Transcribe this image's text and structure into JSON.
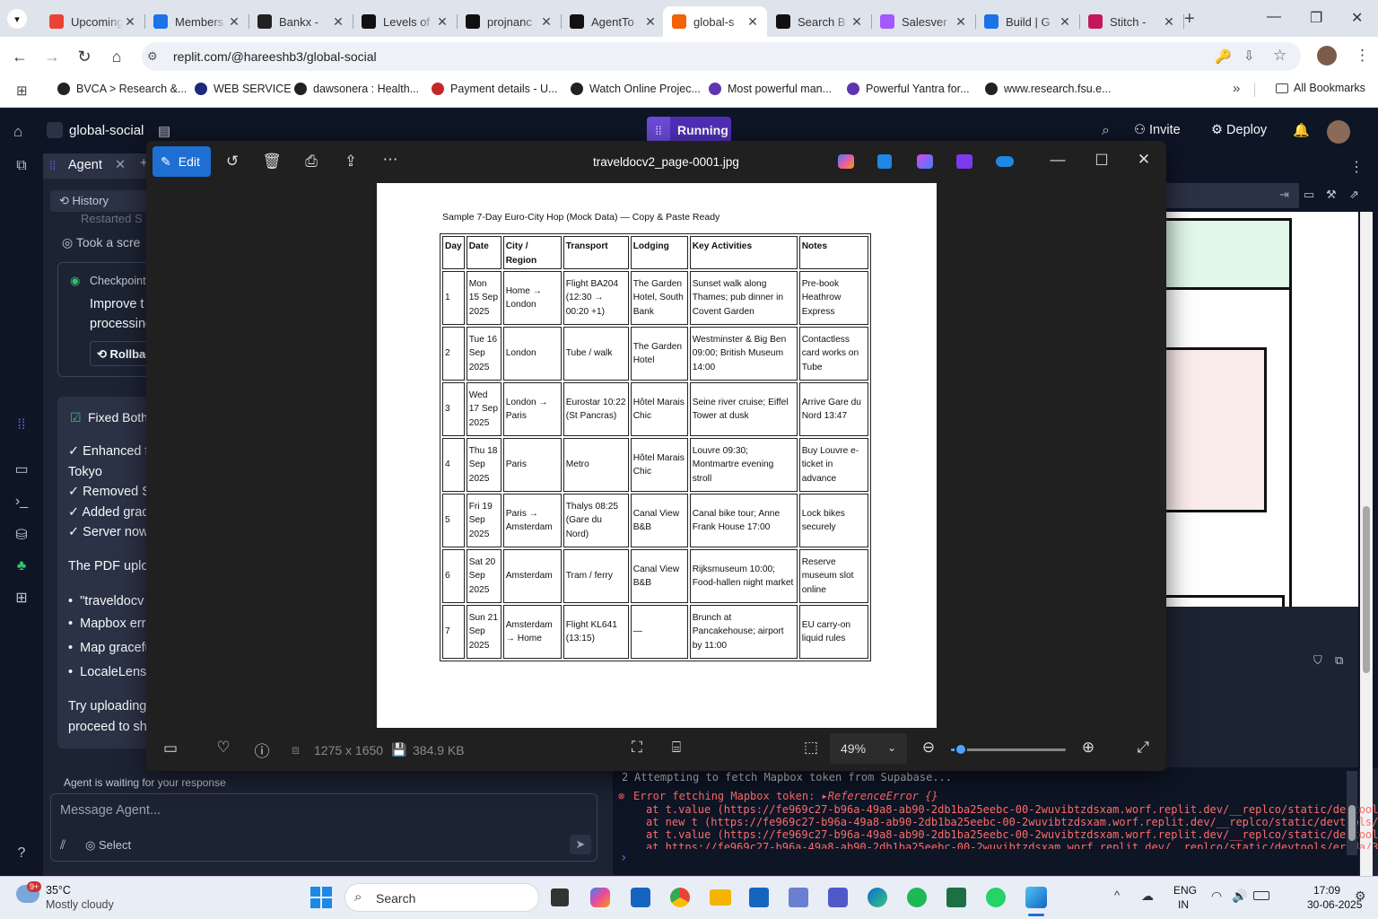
{
  "browser": {
    "tabs": [
      {
        "title": "Upcoming",
        "icon": "gmail-icon",
        "color": "#ea4335"
      },
      {
        "title": "Members",
        "icon": "globe-icon",
        "color": "#1a73e8"
      },
      {
        "title": "Bankx - ",
        "icon": "openai-icon",
        "color": "#222222"
      },
      {
        "title": "Levels of",
        "icon": "notion-icon",
        "color": "#111111"
      },
      {
        "title": "projnanc",
        "icon": "github-icon",
        "color": "#111111"
      },
      {
        "title": "AgentTo",
        "icon": "github-icon",
        "color": "#111111"
      },
      {
        "title": "global-s",
        "icon": "replit-icon",
        "color": "#f26207",
        "active": true
      },
      {
        "title": "Search B",
        "icon": "perplexity-icon",
        "color": "#111111"
      },
      {
        "title": "Salesver",
        "icon": "figma-icon",
        "color": "#a259ff"
      },
      {
        "title": "Build | G",
        "icon": "build-icon",
        "color": "#1a73e8"
      },
      {
        "title": "Stitch - ",
        "icon": "stitch-icon",
        "color": "#c2185b"
      }
    ],
    "url": "replit.com/@hareeshb3/global-social",
    "bookmarks": [
      {
        "label": "BVCA > Research &...",
        "color": "#222"
      },
      {
        "label": "WEB SERVICE",
        "color": "#1b2a7a"
      },
      {
        "label": "dawsonera : Health...",
        "color": "#222"
      },
      {
        "label": "Payment details - U...",
        "color": "#c62828"
      },
      {
        "label": "Watch Online Projec...",
        "color": "#222"
      },
      {
        "label": "Most powerful man...",
        "color": "#5e35b1"
      },
      {
        "label": "Powerful Yantra for...",
        "color": "#5e35b1"
      },
      {
        "label": "www.research.fsu.e...",
        "color": "#222"
      }
    ],
    "all_bookmarks": "All Bookmarks"
  },
  "replit": {
    "project": "global-social",
    "status": "Running",
    "invite": "Invite",
    "deploy": "Deploy",
    "agent_tab": "Agent",
    "history": "History",
    "restarted": "Restarted S",
    "took_screenshot": "Took a scre",
    "checkpoint": "Checkpoint",
    "checkpoint_desc_1": "Improve t",
    "checkpoint_desc_2": "processing",
    "rollback": "Rollbac",
    "fixed_title": "Fixed Both",
    "msg_lines": [
      "✓ Enhanced fi",
      "Tokyo",
      "✓ Removed Su",
      "✓ Added grac",
      "✓ Server now"
    ],
    "pdf_upload": "The PDF uploa",
    "bullets": [
      "\"traveldocv",
      "Mapbox erro",
      "Map gracefu",
      "LocaleLens"
    ],
    "try_lines": [
      "Try uploading",
      "proceed to sh"
    ],
    "waiting": "Agent is waiting for your response",
    "message_placeholder": "Message Agent...",
    "select": "Select",
    "console": {
      "line_num": "2",
      "line1": "Attempting to fetch Mapbox token from Supabase...",
      "error": "Error fetching Mapbox token: ",
      "error_type": "ReferenceError {}",
      "stack": [
        "at t.value (https://fe969c27-b96a-49a8-ab90-2db1ba25eebc-00-2wuvibtzdsxam.worf.replit.dev/__replco/static/devtools/eru",
        "at new t (https://fe969c27-b96a-49a8-ab90-2db1ba25eebc-00-2wuvibtzdsxam.worf.replit.dev/__replco/static/devtools/eru",
        "at t.value (https://fe969c27-b96a-49a8-ab90-2db1ba25eebc-00-2wuvibtzdsxam.worf.replit.dev/__replco/static/devtools/eru",
        "at https://fe969c27-b96a-49a8-ab90-2db1ba25eebc-00-2wuvibtzdsxam.worf.replit.dev/__replco/static/devtools/eruda/3.2"
      ]
    }
  },
  "viewer": {
    "edit": "Edit",
    "filename": "traveldocv2_page-0001.jpg",
    "dimensions": "1275 x 1650",
    "filesize": "384.9 KB",
    "zoom": "49%",
    "zoom_level": 0.08,
    "doc": {
      "title": "Sample 7-Day Euro-City Hop (Mock Data) — Copy & Paste Ready",
      "headers": [
        "Day",
        "Date",
        "City / Region",
        "Transport",
        "Lodging",
        "Key Activities",
        "Notes"
      ],
      "rows": [
        [
          "1",
          "Mon 15 Sep 2025",
          "Home → London",
          "Flight BA204 (12:30 → 00:20 +1)",
          "The Garden Hotel, South Bank",
          "Sunset walk along Thames; pub dinner in Covent Garden",
          "Pre-book Heathrow Express"
        ],
        [
          "2",
          "Tue 16 Sep 2025",
          "London",
          "Tube / walk",
          "The Garden Hotel",
          "Westminster & Big Ben 09:00; British Museum 14:00",
          "Contactless card works on Tube"
        ],
        [
          "3",
          "Wed 17 Sep 2025",
          "London → Paris",
          "Eurostar 10:22 (St Pancras)",
          "Hôtel Marais Chic",
          "Seine river cruise; Eiffel Tower at dusk",
          "Arrive Gare du Nord 13:47"
        ],
        [
          "4",
          "Thu 18 Sep 2025",
          "Paris",
          "Metro",
          "Hôtel Marais Chic",
          "Louvre 09:30; Montmartre evening stroll",
          "Buy Louvre e-ticket in advance"
        ],
        [
          "5",
          "Fri 19 Sep 2025",
          "Paris → Amsterdam",
          "Thalys 08:25 (Gare du Nord)",
          "Canal View B&B",
          "Canal bike tour; Anne Frank House 17:00",
          "Lock bikes securely"
        ],
        [
          "6",
          "Sat 20 Sep 2025",
          "Amsterdam",
          "Tram / ferry",
          "Canal View B&B",
          "Rijksmuseum 10:00; Food-hallen night market",
          "Reserve museum slot online"
        ],
        [
          "7",
          "Sun 21 Sep 2025",
          "Amsterdam → Home",
          "Flight KL641 (13:15)",
          "—",
          "Brunch at Pancakehouse; airport by 11:00",
          "EU carry-on liquid rules"
        ]
      ]
    }
  },
  "taskbar": {
    "temperature": "35°C",
    "weather": "Mostly cloudy",
    "notif_badge": "9+",
    "search": "Search",
    "lang1": "ENG",
    "lang2": "IN",
    "time": "17:09",
    "date": "30-06-2025"
  }
}
